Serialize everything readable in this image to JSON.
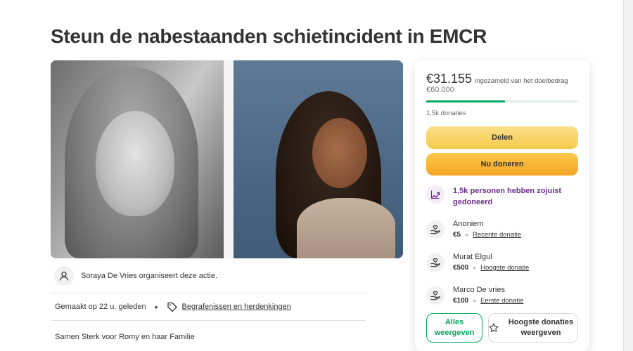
{
  "campaign": {
    "title": "Steun de nabestaanden schietincident in EMCR",
    "organizer_text": "Soraya De Vries organiseert deze actie.",
    "created": "Gemaakt op 22 u. geleden",
    "category": "Begrafenissen en herdenkingen",
    "story_intro": "Samen Sterk voor Romy en haar Familie"
  },
  "donation_panel": {
    "raised": "€31.155",
    "raised_suffix": "ingezameld van het doelbedrag",
    "goal": "€60.000",
    "progress_fraction": 0.52,
    "donation_count": "1,5k donaties",
    "share_label": "Delen",
    "donate_label": "Nu doneren",
    "trending_text": "1,5k personen hebben zojuist gedoneerd",
    "donors": [
      {
        "name": "Anoniem",
        "amount": "€5",
        "type": "Recente donatie"
      },
      {
        "name": "Murat Elgul",
        "amount": "€500",
        "type": "Hoogste donatie"
      },
      {
        "name": "Marco De vries",
        "amount": "€100",
        "type": "Eerste donatie"
      }
    ],
    "see_all_label": "Alles weergeven",
    "top_donations_label": "Hoogste donaties weergeven"
  },
  "icons": {
    "organizer": "person-icon",
    "category": "tag-icon",
    "trending": "trending-up-icon",
    "donor": "heart-hand-icon",
    "top_donations": "star-icon"
  },
  "colors": {
    "brand_green": "#02a95c",
    "trending_purple": "#6a2d8c",
    "donate_orange": "#f5a425",
    "share_yellow": "#f6c94a"
  }
}
